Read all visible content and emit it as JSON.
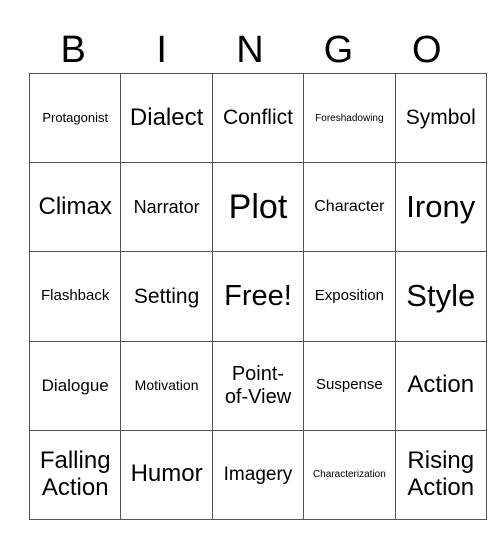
{
  "header": [
    "B",
    "I",
    "N",
    "G",
    "O"
  ],
  "rows": [
    [
      {
        "t": "Protagonist",
        "s": 13
      },
      {
        "t": "Dialect",
        "s": 24
      },
      {
        "t": "Conflict",
        "s": 21
      },
      {
        "t": "Foreshadowing",
        "s": 10
      },
      {
        "t": "Symbol",
        "s": 21
      }
    ],
    [
      {
        "t": "Climax",
        "s": 24
      },
      {
        "t": "Narrator",
        "s": 18
      },
      {
        "t": "Plot",
        "s": 34
      },
      {
        "t": "Character",
        "s": 16
      },
      {
        "t": "Irony",
        "s": 31
      }
    ],
    [
      {
        "t": "Flashback",
        "s": 15
      },
      {
        "t": "Setting",
        "s": 21
      },
      {
        "t": "Free!",
        "s": 29
      },
      {
        "t": "Exposition",
        "s": 15
      },
      {
        "t": "Style",
        "s": 31
      }
    ],
    [
      {
        "t": "Dialogue",
        "s": 17
      },
      {
        "t": "Motivation",
        "s": 14
      },
      {
        "t": "Point-of-View",
        "s": 20
      },
      {
        "t": "Suspense",
        "s": 15
      },
      {
        "t": "Action",
        "s": 24
      }
    ],
    [
      {
        "t": "Falling Action",
        "s": 24
      },
      {
        "t": "Humor",
        "s": 24
      },
      {
        "t": "Imagery",
        "s": 19
      },
      {
        "t": "Characterization",
        "s": 10
      },
      {
        "t": "Rising Action",
        "s": 24
      }
    ]
  ]
}
